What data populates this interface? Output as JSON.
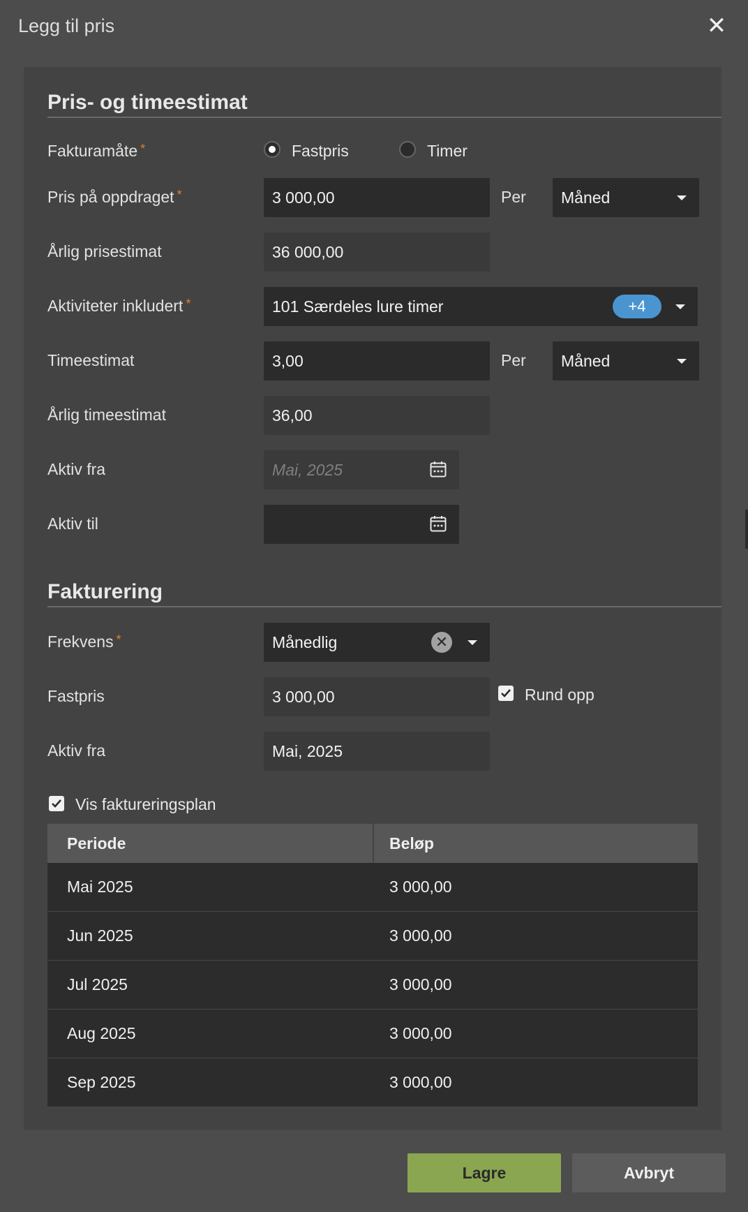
{
  "dialog": {
    "title": "Legg til pris",
    "close_glyph": "✕"
  },
  "price_section": {
    "title": "Pris- og timeestimat",
    "required_mark": "*",
    "billing_method": {
      "label": "Fakturamåte",
      "options": [
        "Fastpris",
        "Timer"
      ],
      "selected": "Fastpris"
    },
    "price": {
      "label": "Pris på oppdraget",
      "value": "3 000,00",
      "per_label": "Per",
      "period": "Måned"
    },
    "annual_price_estimate": {
      "label": "Årlig prisestimat",
      "value": "36 000,00"
    },
    "activities": {
      "label": "Aktiviteter inkludert",
      "value": "101 Særdeles lure timer",
      "more_badge": "+4"
    },
    "hour_estimate": {
      "label": "Timeestimat",
      "value": "3,00",
      "per_label": "Per",
      "period": "Måned"
    },
    "annual_hour_estimate": {
      "label": "Årlig timeestimat",
      "value": "36,00"
    },
    "active_from": {
      "label": "Aktiv fra",
      "placeholder": "Mai, 2025"
    },
    "active_to": {
      "label": "Aktiv til",
      "value": ""
    }
  },
  "billing_section": {
    "title": "Fakturering",
    "frequency": {
      "label": "Frekvens",
      "value": "Månedlig"
    },
    "fixed_price": {
      "label": "Fastpris",
      "value": "3 000,00",
      "round_up_label": "Rund opp",
      "round_up_checked": true
    },
    "active_from": {
      "label": "Aktiv fra",
      "value": "Mai, 2025"
    },
    "show_plan": {
      "label": "Vis faktureringsplan",
      "checked": true
    },
    "plan_table": {
      "columns": [
        "Periode",
        "Beløp"
      ],
      "rows": [
        [
          "Mai 2025",
          "3 000,00"
        ],
        [
          "Jun 2025",
          "3 000,00"
        ],
        [
          "Jul 2025",
          "3 000,00"
        ],
        [
          "Aug 2025",
          "3 000,00"
        ],
        [
          "Sep 2025",
          "3 000,00"
        ]
      ]
    }
  },
  "footer": {
    "save_label": "Lagre",
    "cancel_label": "Avbryt"
  },
  "colors": {
    "save": "#8aa650",
    "badge": "#4a95d0",
    "required": "#d9822b"
  },
  "icons": [
    "close-icon",
    "chevron-down-icon",
    "calendar-icon",
    "clear-icon",
    "checkmark-icon"
  ]
}
